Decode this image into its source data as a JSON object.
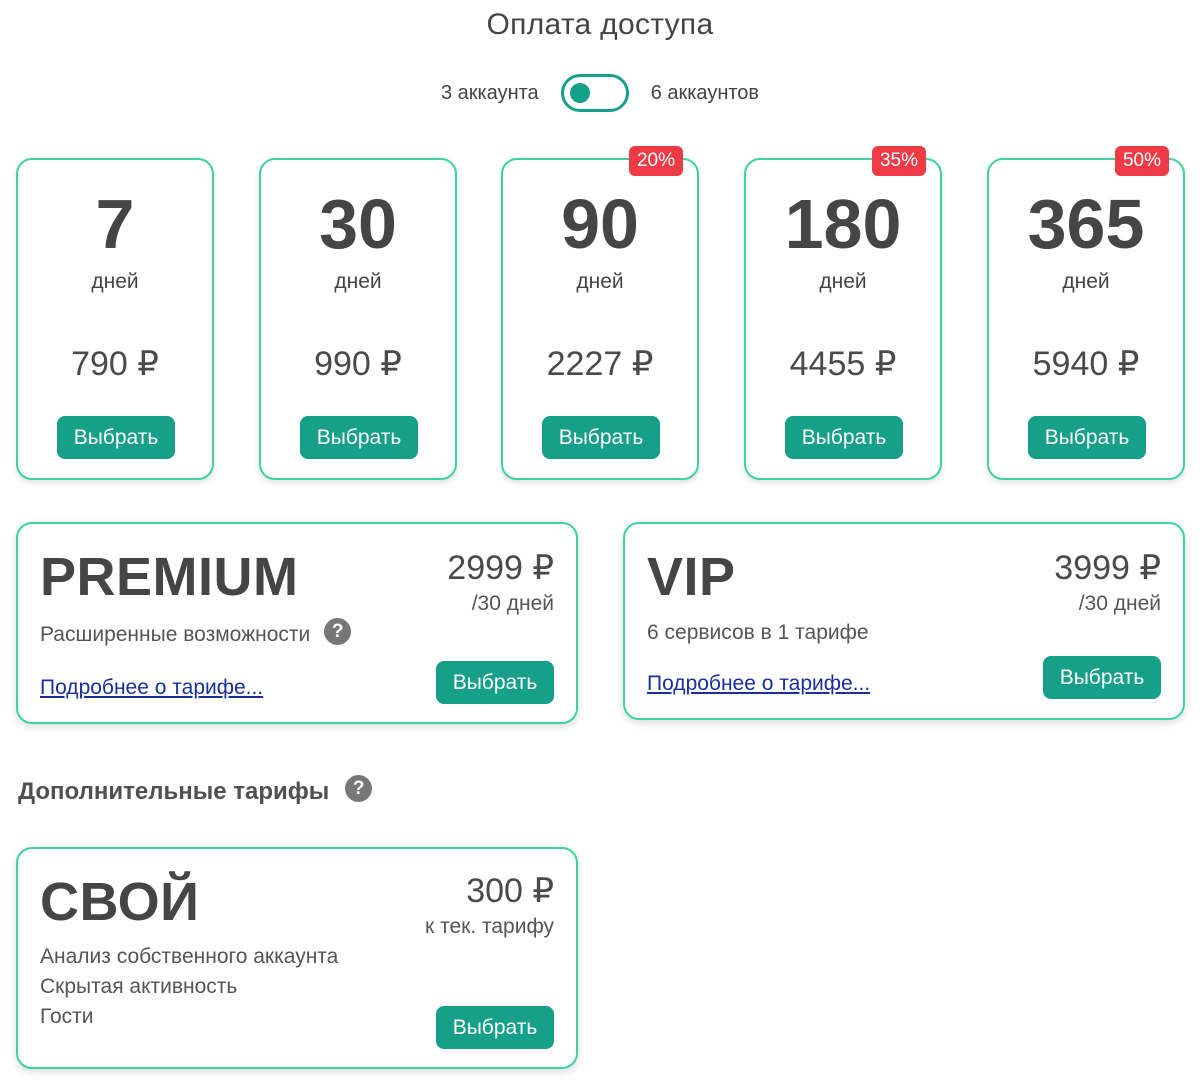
{
  "title": "Оплата доступа",
  "toggle": {
    "left_label": "3 аккаунта",
    "right_label": "6 аккаунтов",
    "state": "left"
  },
  "plans": [
    {
      "days": "7",
      "unit": "дней",
      "price": "790 ₽",
      "button": "Выбрать",
      "badge": ""
    },
    {
      "days": "30",
      "unit": "дней",
      "price": "990 ₽",
      "button": "Выбрать",
      "badge": ""
    },
    {
      "days": "90",
      "unit": "дней",
      "price": "2227 ₽",
      "button": "Выбрать",
      "badge": "20%"
    },
    {
      "days": "180",
      "unit": "дней",
      "price": "4455 ₽",
      "button": "Выбрать",
      "badge": "35%"
    },
    {
      "days": "365",
      "unit": "дней",
      "price": "5940 ₽",
      "button": "Выбрать",
      "badge": "50%"
    }
  ],
  "premium": {
    "name": "PREMIUM",
    "price": "2999 ₽",
    "period": "/30 дней",
    "description": "Расширенные возможности",
    "link": "Подробнее о тарифе...",
    "button": "Выбрать"
  },
  "vip": {
    "name": "VIP",
    "price": "3999 ₽",
    "period": "/30 дней",
    "description": "6 сервисов в 1 тарифе",
    "link": "Подробнее о тарифе...",
    "button": "Выбрать"
  },
  "additional": {
    "title": "Дополнительные тарифы",
    "custom": {
      "name": "СВОЙ",
      "price": "300 ₽",
      "period": "к тек. тарифу",
      "features": [
        "Анализ собственного аккаунта",
        "Скрытая активность",
        "Гости"
      ],
      "button": "Выбрать"
    }
  },
  "icons": {
    "help": "question-icon"
  },
  "colors": {
    "accent": "#16a08a",
    "border": "#3dd49b",
    "badge": "#ef3b46",
    "link": "#1a2f9e"
  }
}
